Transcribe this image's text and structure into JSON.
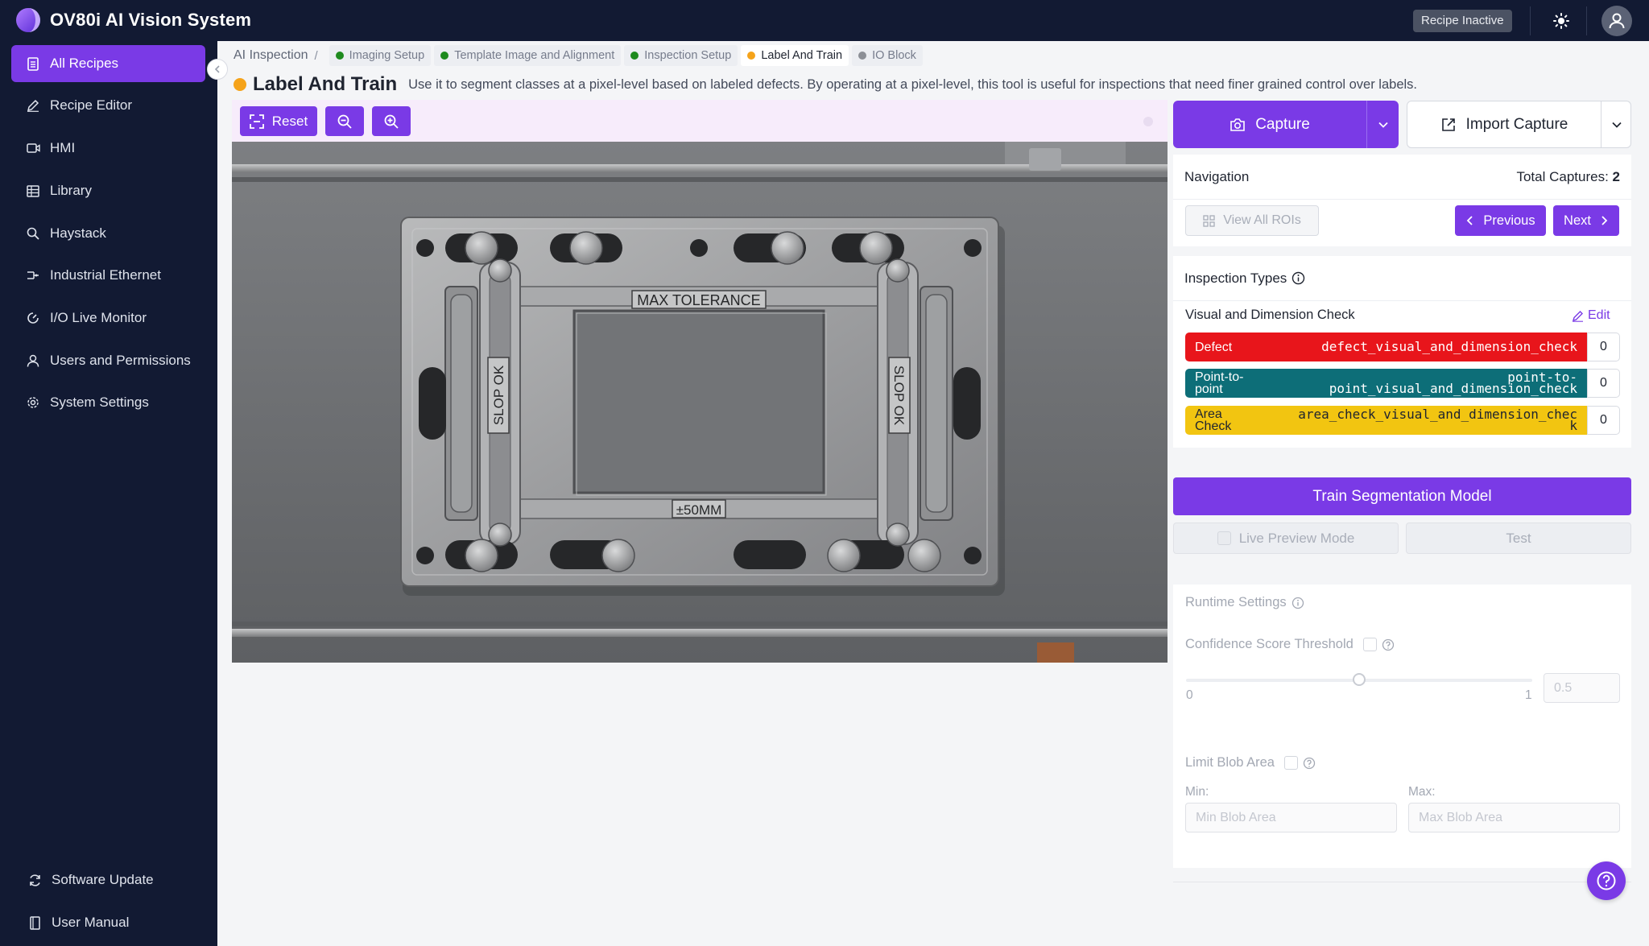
{
  "app": {
    "title": "OV80i AI Vision System",
    "recipe_status": "Recipe Inactive"
  },
  "sidebar": {
    "items": [
      {
        "label": "All Recipes",
        "icon": "document-icon"
      },
      {
        "label": "Recipe Editor",
        "icon": "pencil-icon"
      },
      {
        "label": "HMI",
        "icon": "video-icon"
      },
      {
        "label": "Library",
        "icon": "grid-icon"
      },
      {
        "label": "Haystack",
        "icon": "search-icon"
      },
      {
        "label": "Industrial Ethernet",
        "icon": "network-icon"
      },
      {
        "label": "I/O Live Monitor",
        "icon": "gauge-icon"
      },
      {
        "label": "Users and Permissions",
        "icon": "user-icon"
      },
      {
        "label": "System Settings",
        "icon": "gear-icon"
      }
    ],
    "footer": [
      {
        "label": "Software Update",
        "icon": "refresh-icon"
      },
      {
        "label": "User Manual",
        "icon": "book-icon"
      }
    ]
  },
  "breadcrumb": {
    "root": "AI Inspection",
    "separator": "/",
    "steps": [
      {
        "label": "Imaging Setup",
        "color": "#1e8a1e"
      },
      {
        "label": "Template Image and Alignment",
        "color": "#1e8a1e"
      },
      {
        "label": "Inspection Setup",
        "color": "#1e8a1e"
      },
      {
        "label": "Label And Train",
        "color": "#f5a31a"
      },
      {
        "label": "IO Block",
        "color": "#8c8f96"
      }
    ]
  },
  "page": {
    "title": "Label And Train",
    "description": "Use it to segment classes at a pixel-level based on labeled defects. By operating at a pixel-level, this tool is useful for inspections that need finer grained control over labels."
  },
  "toolbar": {
    "reset_label": "Reset"
  },
  "image": {
    "plate_top_label": "MAX TOLERANCE",
    "plate_bottom_label": "±50MM",
    "left_slot_label": "SLOP OK",
    "right_slot_label": "SLOP OK"
  },
  "capture": {
    "capture_label": "Capture",
    "import_label": "Import Capture"
  },
  "navigation": {
    "title": "Navigation",
    "total_label": "Total Captures:",
    "total_value": "2",
    "view_all_label": "View All ROIs",
    "previous_label": "Previous",
    "next_label": "Next"
  },
  "inspection_types": {
    "title": "Inspection Types",
    "group_name": "Visual and Dimension Check",
    "edit_label": "Edit",
    "classes": [
      {
        "name": "Defect",
        "key": "defect_visual_and_dimension_check",
        "count": "0",
        "color": "#e8151b",
        "text_color": "#ffffff"
      },
      {
        "name_line1": "Point-to-",
        "name_line2": "point",
        "key_line1": "point-to-",
        "key_line2": "point_visual_and_dimension_check",
        "count": "0",
        "color": "#0d6e78",
        "text_color": "#ffffff"
      },
      {
        "name_line1": "Area",
        "name_line2": "Check",
        "key_line1": "area_check_visual_and_dimension_chec",
        "key_line2": "k",
        "count": "0",
        "color": "#f2c511",
        "text_color": "#1f2430"
      }
    ]
  },
  "train": {
    "label": "Train Segmentation Model",
    "live_preview_label": "Live Preview Mode",
    "test_label": "Test"
  },
  "runtime": {
    "title": "Runtime Settings",
    "confidence_label": "Confidence Score Threshold",
    "slider_min": "0",
    "slider_max": "1",
    "confidence_value": "0.5",
    "blob_label": "Limit Blob Area",
    "min_label": "Min:",
    "max_label": "Max:",
    "min_placeholder": "Min Blob Area",
    "max_placeholder": "Max Blob Area"
  },
  "colors": {
    "accent": "#7a3ae6",
    "nav_bg": "#121a33"
  }
}
